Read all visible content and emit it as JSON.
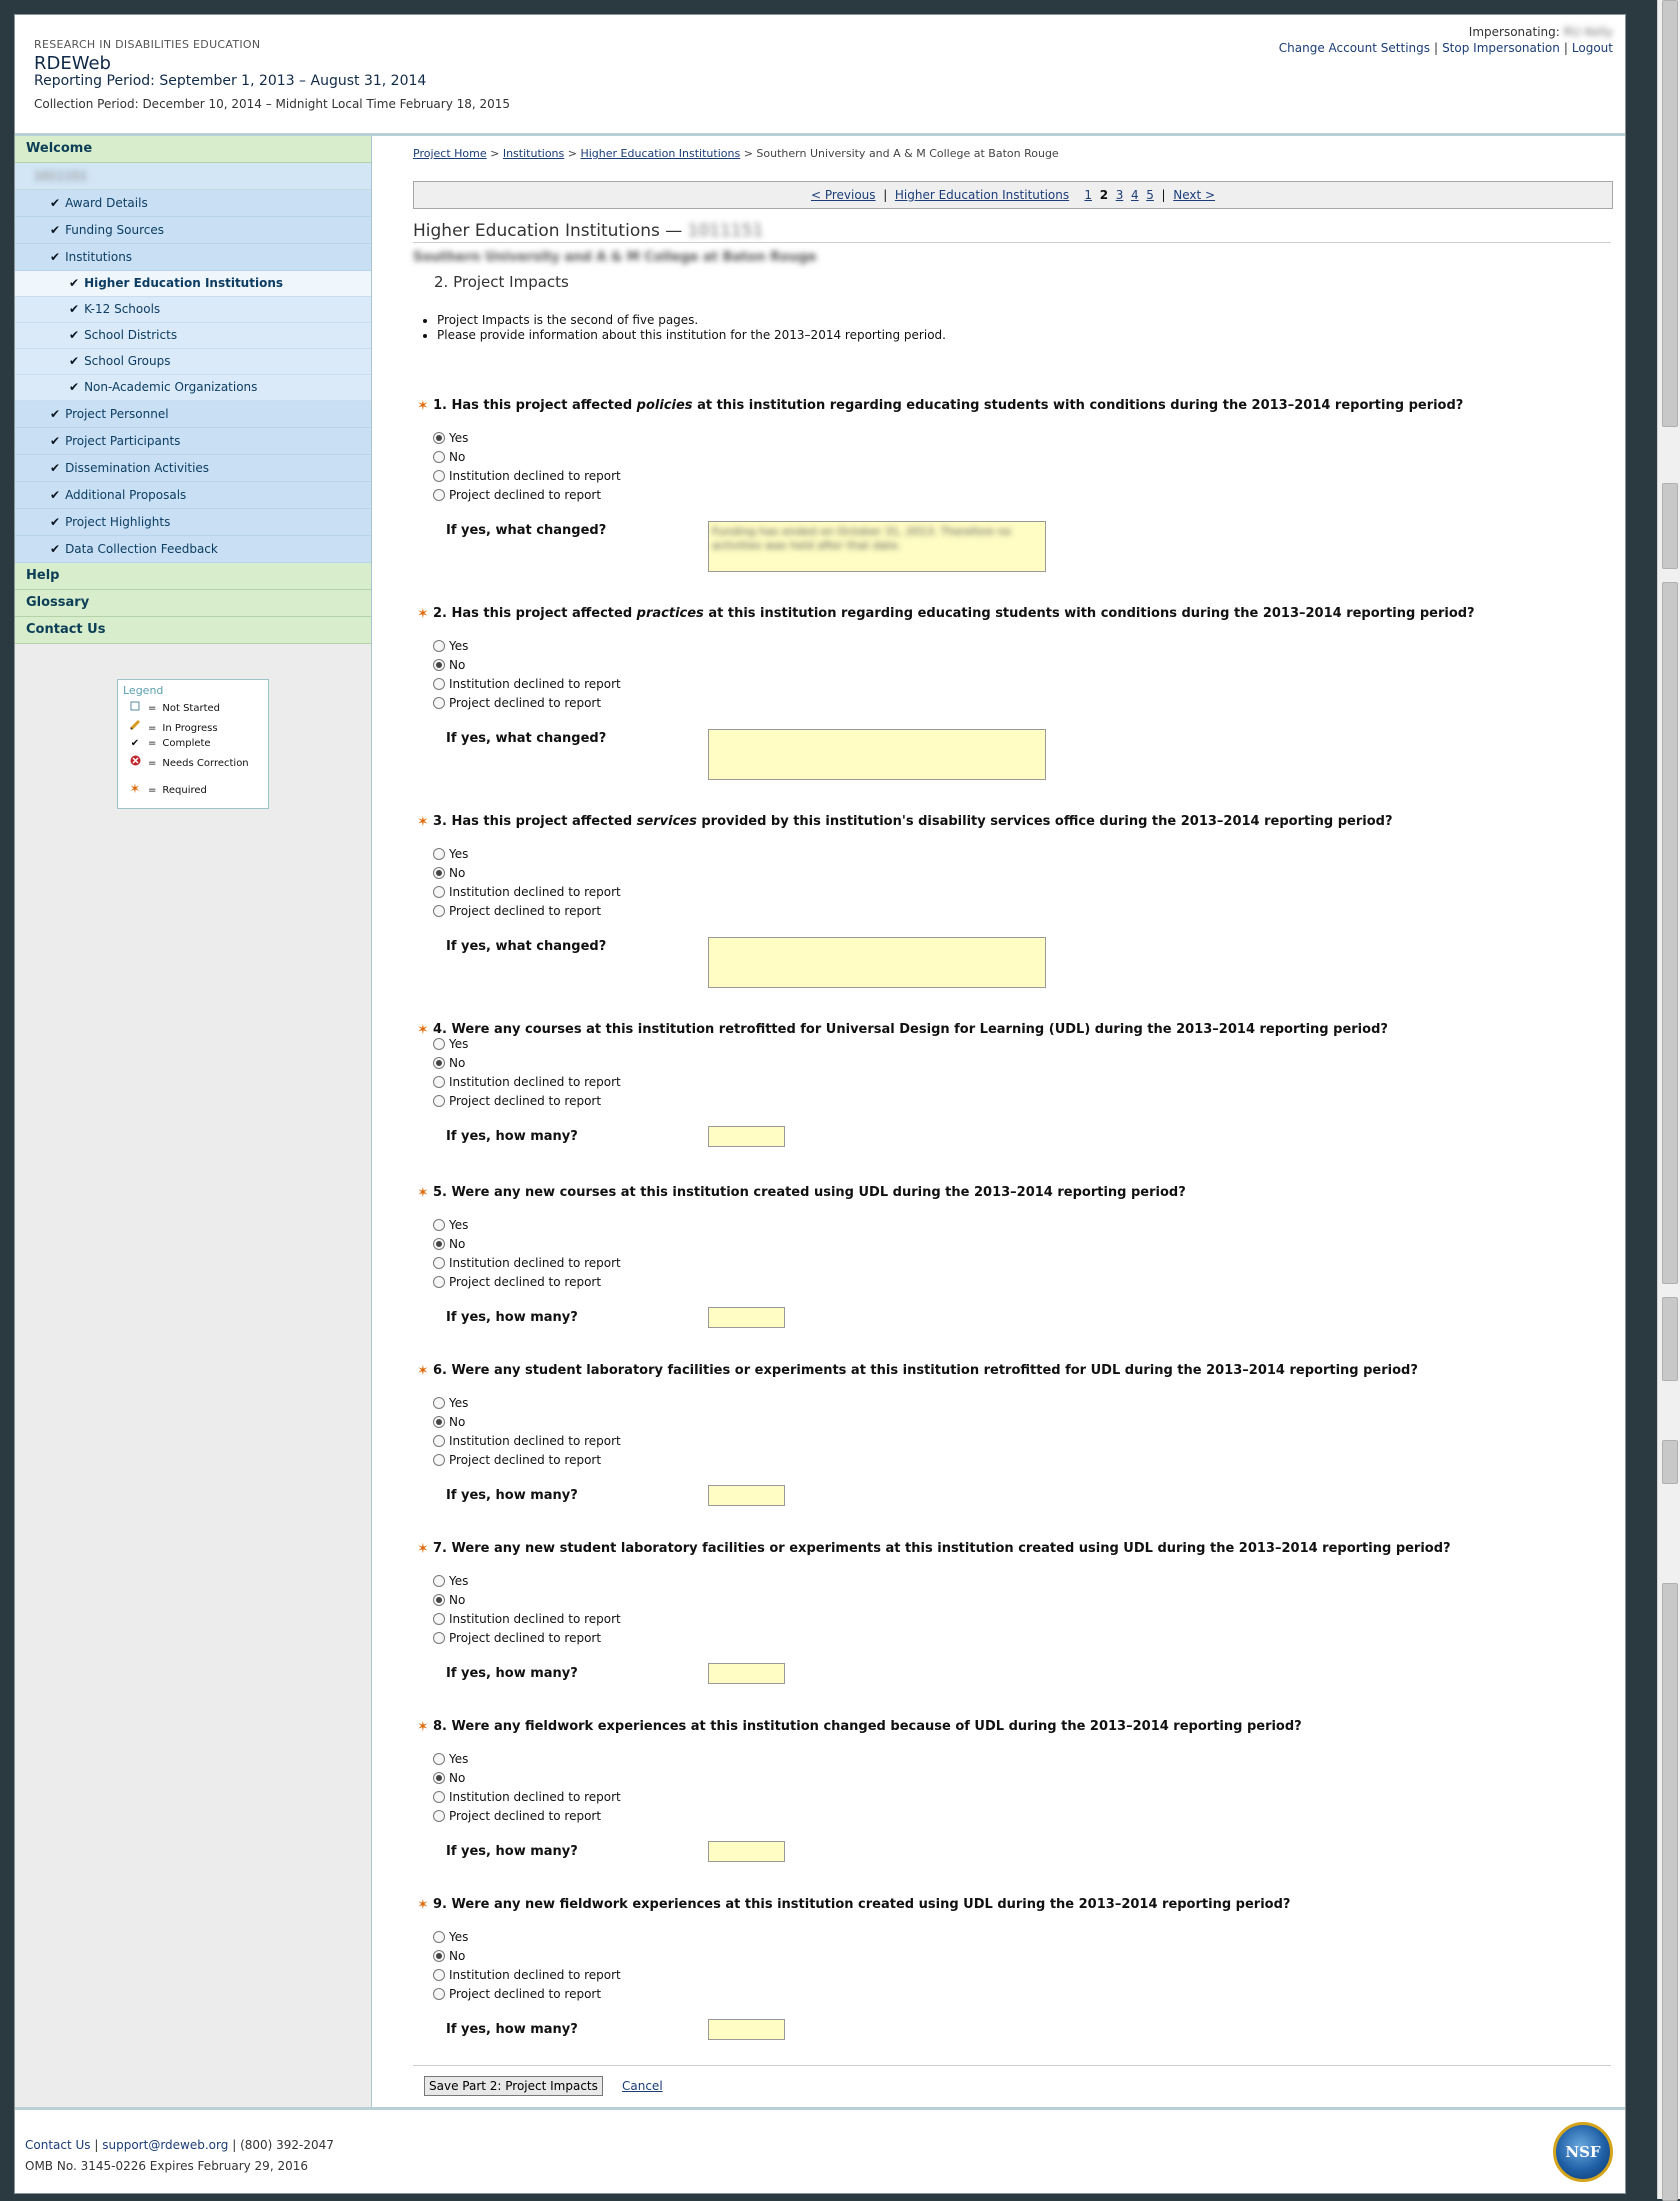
{
  "header": {
    "org": "RESEARCH IN DISABILITIES EDUCATION",
    "site": "RDEWeb",
    "reporting_period": "Reporting Period: September 1, 2013 – August 31, 2014",
    "collection_period": "Collection Period: December 10, 2014 – Midnight Local Time February 18, 2015",
    "impersonating_label": "Impersonating:",
    "impersonating_user": "RU Kelly",
    "links": [
      "Change Account Settings",
      "Stop Impersonation",
      "Logout"
    ]
  },
  "sidebar": {
    "welcome": "Welcome",
    "project_id": "1011151",
    "items": [
      {
        "label": "Award Details",
        "status": "complete"
      },
      {
        "label": "Funding Sources",
        "status": "complete"
      },
      {
        "label": "Institutions",
        "status": "complete"
      },
      {
        "label": "Higher Education Institutions",
        "status": "complete"
      },
      {
        "label": "K-12 Schools",
        "status": "complete"
      },
      {
        "label": "School Districts",
        "status": "complete"
      },
      {
        "label": "School Groups",
        "status": "complete"
      },
      {
        "label": "Non-Academic Organizations",
        "status": "complete"
      },
      {
        "label": "Project Personnel",
        "status": "complete"
      },
      {
        "label": "Project Participants",
        "status": "complete"
      },
      {
        "label": "Dissemination Activities",
        "status": "complete"
      },
      {
        "label": "Additional Proposals",
        "status": "complete"
      },
      {
        "label": "Project Highlights",
        "status": "complete"
      },
      {
        "label": "Data Collection Feedback",
        "status": "complete"
      }
    ],
    "help": "Help",
    "glossary": "Glossary",
    "contact": "Contact Us",
    "check_glyph": "✔"
  },
  "legend": {
    "title": "Legend",
    "eq": "=",
    "not_started": "Not Started",
    "in_progress": "In Progress",
    "complete": "Complete",
    "needs_correction": "Needs Correction",
    "required": "Required"
  },
  "breadcrumb": {
    "project_home": "Project Home",
    "institutions": "Institutions",
    "hei": "Higher Education Institutions",
    "current": "Southern University and A & M College at Baton Rouge",
    "sep": ">"
  },
  "pager": {
    "previous": "< Previous",
    "section": "Higher Education Institutions",
    "pages": [
      "1",
      "2",
      "3",
      "4",
      "5"
    ],
    "current_page": "2",
    "next": "Next >",
    "sep": "|"
  },
  "page": {
    "title": "Higher Education Institutions —",
    "title_id": "1011151",
    "institution": "Southern University and A & M College at Baton Rouge",
    "part": "2. Project Impacts",
    "notes": [
      "Project Impacts is the second of five pages.",
      "Please provide information about this institution for the 2013–2014 reporting period."
    ]
  },
  "options": [
    "Yes",
    "No",
    "Institution declined to report",
    "Project declined to report"
  ],
  "questions": {
    "q1": {
      "pre": "1. Has this project affected ",
      "em": "policies",
      "post": " at this institution regarding educating students with conditions during the 2013–2014 reporting period?",
      "followup": "If yes, what changed?",
      "selected": "Yes",
      "answer": "Funding has ended on October 31, 2013. Therefore no activities was held after that date."
    },
    "q2": {
      "pre": "2. Has this project affected ",
      "em": "practices",
      "post": " at this institution regarding educating students with conditions during the 2013–2014 reporting period?",
      "followup": "If yes, what changed?",
      "selected": "No"
    },
    "q3": {
      "pre": "3. Has this project affected ",
      "em": "services",
      "post": " provided by this institution's disability services office during the 2013–2014 reporting period?",
      "followup": "If yes, what changed?",
      "selected": "No"
    },
    "q4": {
      "text": "4. Were any courses at this institution retrofitted for Universal Design for Learning (UDL) during the 2013–2014 reporting period?",
      "followup": "If yes, how many?",
      "selected": "No"
    },
    "q5": {
      "text": "5. Were any new courses at this institution created using UDL during the 2013–2014 reporting period?",
      "followup": "If yes, how many?",
      "selected": "No"
    },
    "q6": {
      "text": "6. Were any student laboratory facilities or experiments at this institution retrofitted for UDL during the 2013–2014 reporting period?",
      "followup": "If yes, how many?",
      "selected": "No"
    },
    "q7": {
      "text": "7. Were any new student laboratory facilities or experiments at this institution created using UDL during the 2013–2014 reporting period?",
      "followup": "If yes, how many?",
      "selected": "No"
    },
    "q8": {
      "text": "8. Were any fieldwork experiences at this institution changed because of UDL during the 2013–2014 reporting period?",
      "followup": "If yes, how many?",
      "selected": "No"
    },
    "q9": {
      "text": "9. Were any new fieldwork experiences at this institution created using UDL during the 2013–2014 reporting period?",
      "followup": "If yes, how many?",
      "selected": "No"
    }
  },
  "actions": {
    "save": "Save Part 2: Project Impacts",
    "cancel": "Cancel"
  },
  "footer": {
    "contact": "Contact Us",
    "email": "support@rdeweb.org",
    "phone": "(800) 392-2047",
    "sep": "|",
    "omb": "OMB No. 3145-0226 Expires February 29, 2016",
    "logo": "NSF"
  },
  "colors": {
    "required_star": "#e06b0a",
    "nav_green": "#d7edcb",
    "nav_blue": "#c9e0f4",
    "textarea_bg": "#fffdc4",
    "link": "#1b3d78"
  }
}
